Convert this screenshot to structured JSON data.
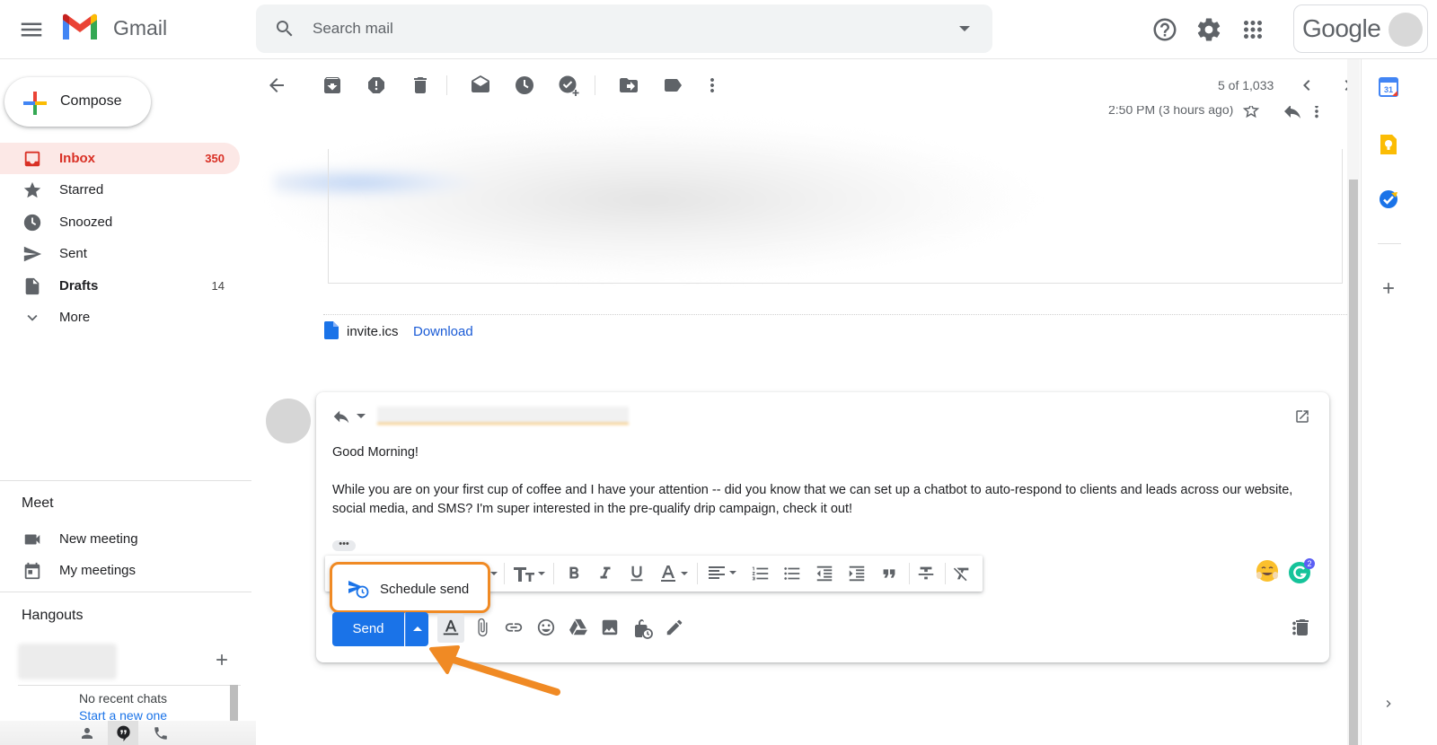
{
  "app": {
    "name": "Gmail"
  },
  "search": {
    "placeholder": "Search mail"
  },
  "header": {
    "brand_word": "Google"
  },
  "compose": {
    "label": "Compose"
  },
  "nav": {
    "items": [
      {
        "label": "Inbox",
        "count": "350"
      },
      {
        "label": "Starred",
        "count": ""
      },
      {
        "label": "Snoozed",
        "count": ""
      },
      {
        "label": "Sent",
        "count": ""
      },
      {
        "label": "Drafts",
        "count": "14"
      },
      {
        "label": "More",
        "count": ""
      }
    ]
  },
  "meet": {
    "title": "Meet",
    "items": [
      {
        "label": "New meeting"
      },
      {
        "label": "My meetings"
      }
    ]
  },
  "hangouts": {
    "title": "Hangouts",
    "empty_text": "No recent chats",
    "start_link": "Start a new one"
  },
  "toolbar": {
    "pager": "5 of 1,033"
  },
  "message": {
    "time": "2:50 PM (3 hours ago)",
    "attachment": {
      "filename": "invite.ics",
      "download_label": "Download"
    }
  },
  "reply": {
    "greeting": "Good Morning!",
    "body": "While you are on your first cup of coffee and I have your attention -- did you know that we can set up a chatbot to auto-respond to clients and leads across our website, social media, and SMS? I'm super interested in the pre-qualify drip campaign, check it out!",
    "ellipsis": "•••",
    "send_label": "Send",
    "schedule_send_label": "Schedule send"
  },
  "annotation": {
    "highlight_color": "#f08a24"
  },
  "colors": {
    "accent": "#1a73e8",
    "inbox_highlight": "#fce8e6",
    "inbox_text": "#d93025"
  }
}
